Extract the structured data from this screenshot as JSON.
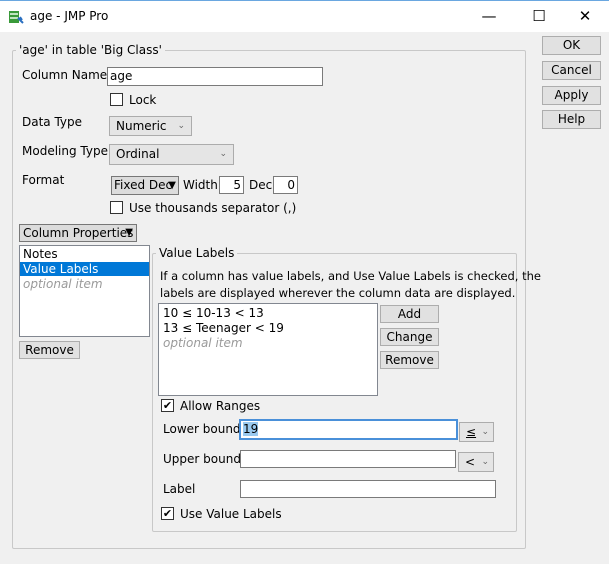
{
  "window": {
    "title": "age - JMP Pro",
    "minimize": "—",
    "maximize": "☐",
    "close": "✕"
  },
  "group_title": "'age' in table 'Big Class'",
  "buttons": {
    "ok": "OK",
    "cancel": "Cancel",
    "apply": "Apply",
    "help": "Help"
  },
  "column_name": {
    "label": "Column Name",
    "value": "age"
  },
  "lock": {
    "label": "Lock",
    "checked": false
  },
  "data_type": {
    "label": "Data Type",
    "value": "Numeric"
  },
  "modeling_type": {
    "label": "Modeling Type",
    "value": "Ordinal"
  },
  "format": {
    "label": "Format",
    "value": "Fixed Dec",
    "width_label": "Width",
    "width": "5",
    "dec_label": "Dec",
    "dec": "0"
  },
  "thousands": {
    "label": "Use thousands separator (,)",
    "checked": false
  },
  "column_properties": {
    "label": "Column Properties",
    "items": [
      "Notes",
      "Value Labels"
    ],
    "optional": "optional item",
    "selected": "Value Labels",
    "remove": "Remove"
  },
  "value_labels": {
    "title": "Value Labels",
    "desc1": "If a column has value labels, and Use Value Labels is checked, the",
    "desc2": "labels are displayed wherever the column data are displayed.",
    "items": [
      "10 ≤ 10-13 < 13",
      "13 ≤ Teenager < 19"
    ],
    "optional": "optional item",
    "add": "Add",
    "change": "Change",
    "remove": "Remove",
    "allow_ranges": "Allow Ranges",
    "lower_label": "Lower bound",
    "lower_value": "19",
    "lower_op": "≤",
    "upper_label": "Upper bound",
    "upper_value": "",
    "upper_op": "<",
    "label_label": "Label",
    "label_value": "",
    "use_value_labels": "Use Value Labels"
  },
  "colors": {
    "accent": "#0078d7"
  }
}
